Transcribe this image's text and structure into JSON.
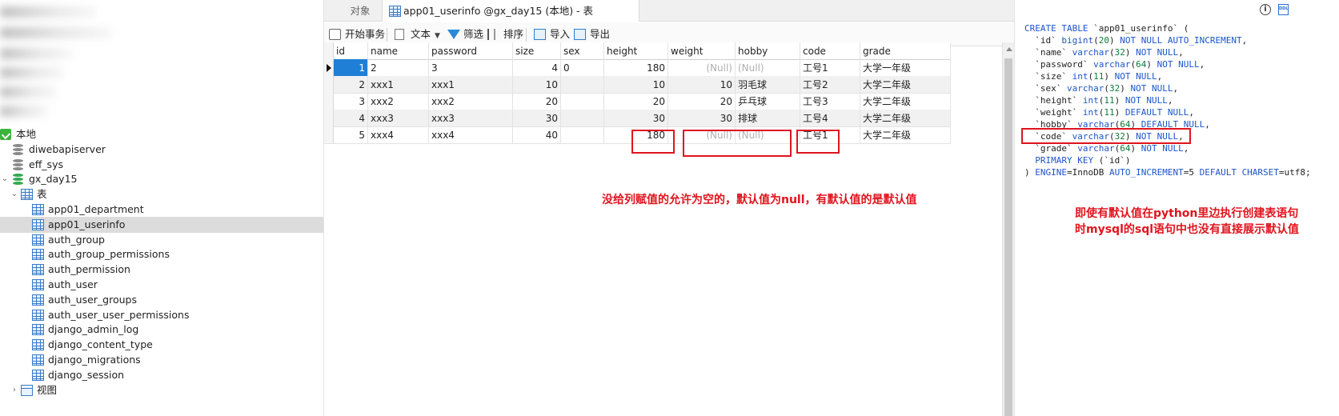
{
  "navigator": {
    "items": [
      {
        "label": "本地",
        "icon": "connection-icon",
        "level": 0
      },
      {
        "label": "diwebapiserver",
        "icon": "database-icon",
        "level": 1
      },
      {
        "label": "eff_sys",
        "icon": "database-icon",
        "level": 1
      },
      {
        "label": "gx_day15",
        "icon": "database-icon-active",
        "level": 1,
        "expanded": true
      },
      {
        "label": "表",
        "icon": "tables-folder-icon",
        "level": 2,
        "expanded": true
      },
      {
        "label": "app01_department",
        "icon": "table-icon",
        "level": 3
      },
      {
        "label": "app01_userinfo",
        "icon": "table-icon",
        "level": 3,
        "selected": true
      },
      {
        "label": "auth_group",
        "icon": "table-icon",
        "level": 3
      },
      {
        "label": "auth_group_permissions",
        "icon": "table-icon",
        "level": 3
      },
      {
        "label": "auth_permission",
        "icon": "table-icon",
        "level": 3
      },
      {
        "label": "auth_user",
        "icon": "table-icon",
        "level": 3
      },
      {
        "label": "auth_user_groups",
        "icon": "table-icon",
        "level": 3
      },
      {
        "label": "auth_user_user_permissions",
        "icon": "table-icon",
        "level": 3
      },
      {
        "label": "django_admin_log",
        "icon": "table-icon",
        "level": 3
      },
      {
        "label": "django_content_type",
        "icon": "table-icon",
        "level": 3
      },
      {
        "label": "django_migrations",
        "icon": "table-icon",
        "level": 3
      },
      {
        "label": "django_session",
        "icon": "table-icon",
        "level": 3
      },
      {
        "label": "视图",
        "icon": "views-folder-icon",
        "level": 2,
        "expanded": false
      }
    ]
  },
  "tabs": {
    "objects": "对象",
    "active": "app01_userinfo @gx_day15 (本地) - 表"
  },
  "toolbar": {
    "begin_transaction": "开始事务",
    "text": "文本",
    "filter": "筛选",
    "sort": "排序",
    "import": "导入",
    "export": "导出"
  },
  "grid": {
    "columns": [
      "id",
      "name",
      "password",
      "size",
      "sex",
      "height",
      "weight",
      "hobby",
      "code",
      "grade"
    ],
    "rows": [
      [
        "1",
        "2",
        "3",
        "4",
        "0",
        "180",
        "(Null)",
        "(Null)",
        "工号1",
        "大学一年级"
      ],
      [
        "2",
        "xxx1",
        "xxx1",
        "10",
        "",
        "10",
        "10",
        "羽毛球",
        "工号2",
        "大学二年级"
      ],
      [
        "3",
        "xxx2",
        "xxx2",
        "20",
        "",
        "20",
        "20",
        "乒乓球",
        "工号3",
        "大学二年级"
      ],
      [
        "4",
        "xxx3",
        "xxx3",
        "30",
        "",
        "30",
        "30",
        "排球",
        "工号4",
        "大学二年级"
      ],
      [
        "5",
        "xxx4",
        "xxx4",
        "40",
        "",
        "180",
        "(Null)",
        "(Null)",
        "工号1",
        "大学二年级"
      ]
    ]
  },
  "annotations": {
    "center_note": "没给列赋值的允许为空的，默认值为null，有默认值的是默认值",
    "right_note_line1": "即使有默认值在python里边执行创建表语句",
    "right_note_line2": "时mysql的sql语句中也没有直接展示默认值"
  },
  "ddl": {
    "lines": [
      "CREATE TABLE `app01_userinfo` (",
      "  `id` bigint(20) NOT NULL AUTO_INCREMENT,",
      "  `name` varchar(32) NOT NULL,",
      "  `password` varchar(64) NOT NULL,",
      "  `size` int(11) NOT NULL,",
      "  `sex` varchar(32) NOT NULL,",
      "  `height` int(11) NOT NULL,",
      "  `weight` int(11) DEFAULT NULL,",
      "  `hobby` varchar(64) DEFAULT NULL,",
      "  `code` varchar(32) NOT NULL,",
      "  `grade` varchar(64) NOT NULL,",
      "  PRIMARY KEY (`id`)",
      ") ENGINE=InnoDB AUTO_INCREMENT=5 DEFAULT CHARSET=utf8;"
    ]
  },
  "colors": {
    "selection": "#1f7fd6",
    "annotation_red": "#e0141e",
    "keyword_blue": "#1d55c9"
  }
}
